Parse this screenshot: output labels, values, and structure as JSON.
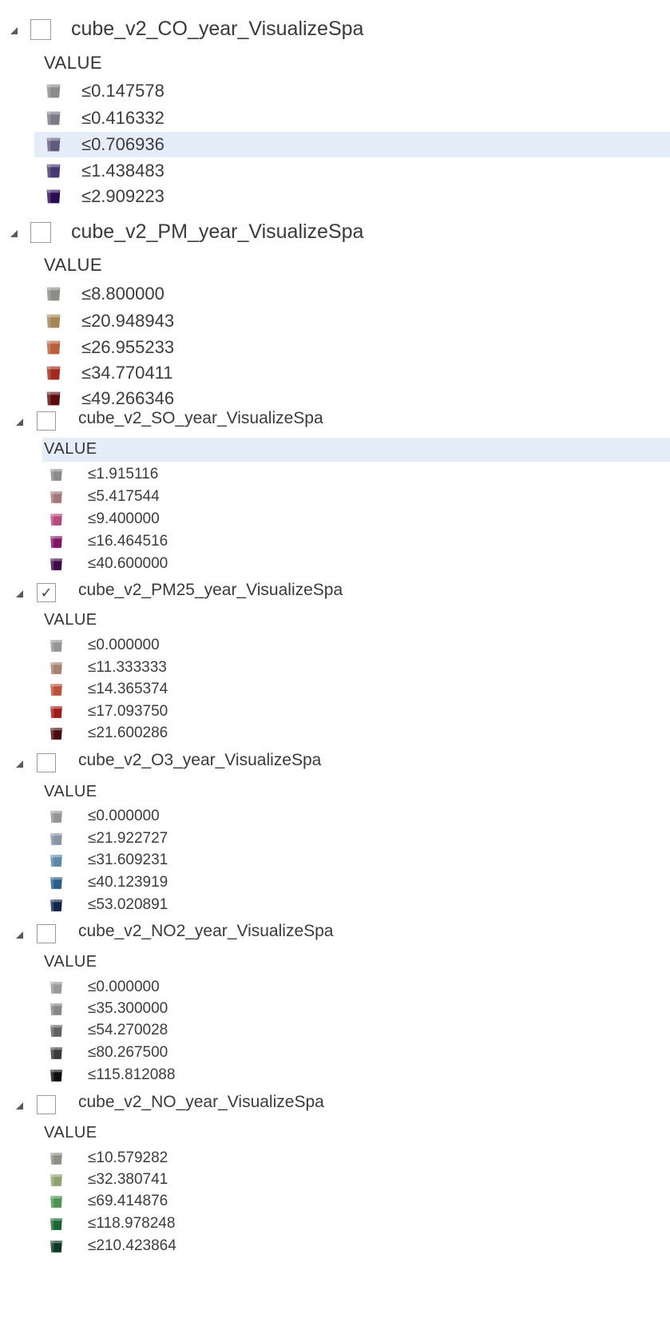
{
  "legend": {
    "layers": [
      {
        "name": "cube_v2_CO_year_VisualizeSpa",
        "checked": false,
        "heading": "VALUE",
        "classes": [
          {
            "label": "≤0.147578",
            "color": "#8c8c8c"
          },
          {
            "label": "≤0.416332",
            "color": "#7c7a86"
          },
          {
            "label": "≤0.706936",
            "color": "#625b80"
          },
          {
            "label": "≤1.438483",
            "color": "#463870"
          },
          {
            "label": "≤2.909223",
            "color": "#2a0c52"
          }
        ],
        "selected_class": 2
      },
      {
        "name": "cube_v2_PM_year_VisualizeSpa",
        "checked": false,
        "heading": "VALUE",
        "classes": [
          {
            "label": "≤8.800000",
            "color": "#8e8c88"
          },
          {
            "label": "≤20.948943",
            "color": "#a28655"
          },
          {
            "label": "≤26.955233",
            "color": "#b8603c"
          },
          {
            "label": "≤34.770411",
            "color": "#a3281d"
          },
          {
            "label": "≤49.266346",
            "color": "#5c0a10"
          }
        ]
      },
      {
        "name": "cube_v2_SO_year_VisualizeSpa",
        "checked": false,
        "heading": "VALUE",
        "heading_selected": true,
        "classes": [
          {
            "label": "≤1.915116",
            "color": "#8c8a8a"
          },
          {
            "label": "≤5.417544",
            "color": "#a27876"
          },
          {
            "label": "≤9.400000",
            "color": "#b8497a"
          },
          {
            "label": "≤16.464516",
            "color": "#821466"
          },
          {
            "label": "≤40.600000",
            "color": "#3c0c4a"
          }
        ]
      },
      {
        "name": "cube_v2_PM25_year_VisualizeSpa",
        "checked": true,
        "heading": "VALUE",
        "classes": [
          {
            "label": "≤0.000000",
            "color": "#949494"
          },
          {
            "label": "≤11.333333",
            "color": "#a88070"
          },
          {
            "label": "≤14.365374",
            "color": "#bb5238"
          },
          {
            "label": "≤17.093750",
            "color": "#a01a1a"
          },
          {
            "label": "≤21.600286",
            "color": "#4a0a0e"
          }
        ]
      },
      {
        "name": "cube_v2_O3_year_VisualizeSpa",
        "checked": false,
        "heading": "VALUE",
        "classes": [
          {
            "label": "≤0.000000",
            "color": "#949494"
          },
          {
            "label": "≤21.922727",
            "color": "#8894a4"
          },
          {
            "label": "≤31.609231",
            "color": "#5a88a6"
          },
          {
            "label": "≤40.123919",
            "color": "#2a5e8c"
          },
          {
            "label": "≤53.020891",
            "color": "#10244c"
          }
        ]
      },
      {
        "name": "cube_v2_NO2_year_VisualizeSpa",
        "checked": false,
        "heading": "VALUE",
        "classes": [
          {
            "label": "≤0.000000",
            "color": "#9a9a9a"
          },
          {
            "label": "≤35.300000",
            "color": "#888888"
          },
          {
            "label": "≤54.270028",
            "color": "#626262"
          },
          {
            "label": "≤80.267500",
            "color": "#3c3c3c"
          },
          {
            "label": "≤115.812088",
            "color": "#0e0e0e"
          }
        ]
      },
      {
        "name": "cube_v2_NO_year_VisualizeSpa",
        "checked": false,
        "heading": "VALUE",
        "classes": [
          {
            "label": "≤10.579282",
            "color": "#8e9086"
          },
          {
            "label": "≤32.380741",
            "color": "#8ea470"
          },
          {
            "label": "≤69.414876",
            "color": "#4e9452"
          },
          {
            "label": "≤118.978248",
            "color": "#1a6634"
          },
          {
            "label": "≤210.423864",
            "color": "#0c3a24"
          }
        ]
      }
    ]
  }
}
